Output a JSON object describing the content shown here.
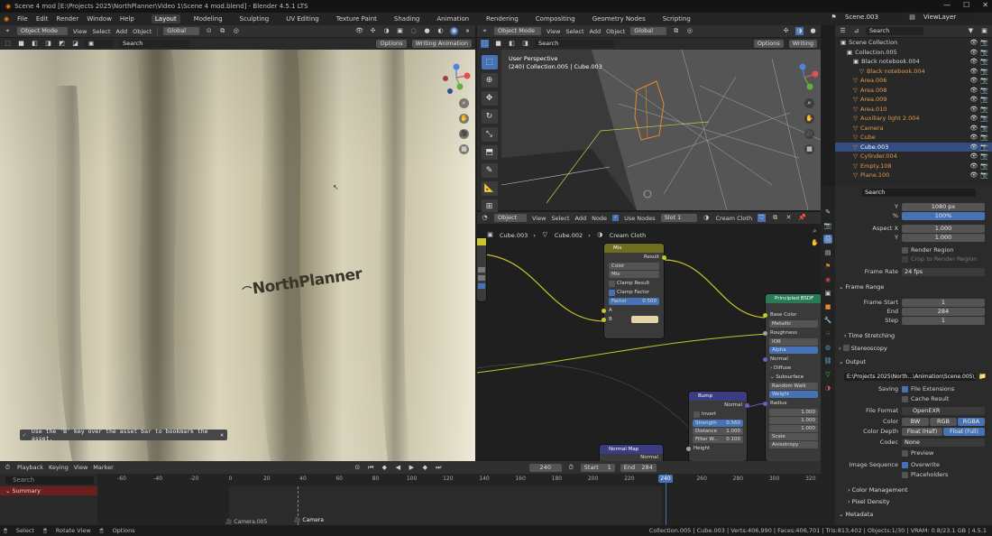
{
  "window": {
    "title": "Scene 4 mod [E:\\Projects 2025\\NorthPlanner\\Video 1\\Scene 4 mod.blend] - Blender 4.5.1 LTS"
  },
  "menu": {
    "items": [
      "File",
      "Edit",
      "Render",
      "Window",
      "Help"
    ]
  },
  "workspaces": [
    "Layout",
    "Modeling",
    "Sculpting",
    "UV Editing",
    "Texture Paint",
    "Shading",
    "Animation",
    "Rendering",
    "Compositing",
    "Geometry Nodes",
    "Scripting"
  ],
  "scene": {
    "name": "Scene.003",
    "view_layer": "ViewLayer"
  },
  "viewport_left": {
    "mode": "Object Mode",
    "menus": [
      "View",
      "Select",
      "Add",
      "Object"
    ],
    "transform": "Global",
    "search_placeholder": "Search",
    "options": "Options",
    "writing": "Writing Animation",
    "brand_text": "NorthPlanner",
    "toast": "Use the 'B' key over the asset bar to bookmark the asset."
  },
  "viewport_right": {
    "mode": "Object Mode",
    "menus": [
      "View",
      "Select",
      "Add",
      "Object"
    ],
    "transform": "Global",
    "options": "Options",
    "writing": "Writing",
    "persp": "User Perspective",
    "info": "(240) Collection.005 | Cube.003"
  },
  "node_editor": {
    "type": "Object",
    "menus": [
      "View",
      "Select",
      "Add",
      "Node"
    ],
    "use_nodes": "Use Nodes",
    "slot": "Slot 1",
    "material": "Cream Cloth",
    "breadcrumb": [
      "Cube.003",
      "Cube.002",
      "Cream Cloth"
    ],
    "mix": {
      "title": "Mix",
      "result": "Result",
      "type": "Color",
      "blend": "Mix",
      "clamp_result": "Clamp Result",
      "clamp_factor": "Clamp Factor",
      "factor_label": "Factor",
      "factor": "0.500",
      "a": "A",
      "b": "B"
    },
    "bsdf": {
      "title": "Principled BSDF",
      "rows": [
        "Base Color",
        "Metallic",
        "Roughness",
        "IOR",
        "Alpha",
        "Normal",
        "Diffuse",
        "Subsurface",
        "Random Walk",
        "Weight",
        "Radius",
        "1.000",
        "1.000",
        "1.000",
        "Scale",
        "Anisotropy"
      ]
    },
    "bump": {
      "title": "Bump",
      "normal": "Normal",
      "invert": "Invert",
      "strength_label": "Strength",
      "strength": "0.560",
      "distance_label": "Distance",
      "distance": "1.000",
      "filter_label": "Filter W...",
      "filter": "0.100",
      "height": "Height"
    },
    "normalmap": {
      "title": "Normal Map",
      "out": "Normal"
    }
  },
  "outliner": {
    "search_placeholder": "Search",
    "rows": [
      {
        "name": "Scene Collection",
        "indent": 0,
        "kind": "scene"
      },
      {
        "name": "Collection.005",
        "indent": 1,
        "kind": "coll"
      },
      {
        "name": "Black notebook.004",
        "indent": 2,
        "kind": "coll"
      },
      {
        "name": "Black notebook.004",
        "indent": 3,
        "kind": "obj"
      },
      {
        "name": "Area.006",
        "indent": 2,
        "kind": "obj"
      },
      {
        "name": "Area.008",
        "indent": 2,
        "kind": "obj"
      },
      {
        "name": "Area.009",
        "indent": 2,
        "kind": "obj"
      },
      {
        "name": "Area.010",
        "indent": 2,
        "kind": "obj"
      },
      {
        "name": "Auxiliary light 2.004",
        "indent": 2,
        "kind": "obj"
      },
      {
        "name": "Camera",
        "indent": 2,
        "kind": "obj"
      },
      {
        "name": "Cube",
        "indent": 2,
        "kind": "obj"
      },
      {
        "name": "Cube.003",
        "indent": 2,
        "kind": "obj",
        "selected": true
      },
      {
        "name": "Cylinder.004",
        "indent": 2,
        "kind": "obj"
      },
      {
        "name": "Empty.108",
        "indent": 2,
        "kind": "obj"
      },
      {
        "name": "Plane.100",
        "indent": 2,
        "kind": "obj"
      }
    ]
  },
  "properties": {
    "search_placeholder": "Search",
    "res_y_label": "Y",
    "res_y": "1080 px",
    "res_pct_label": "%",
    "res_pct": "100%",
    "aspect_x_label": "Aspect X",
    "aspect_x": "1.000",
    "aspect_y_label": "Y",
    "aspect_y": "1.000",
    "render_region": "Render Region",
    "crop_region": "Crop to Render Region",
    "frame_rate_label": "Frame Rate",
    "frame_rate": "24 fps",
    "frame_range": "Frame Range",
    "frame_start_label": "Frame Start",
    "frame_start": "1",
    "end_label": "End",
    "end": "284",
    "step_label": "Step",
    "step": "1",
    "time_stretching": "Time Stretching",
    "stereoscopy": "Stereoscopy",
    "output": "Output",
    "output_path": "E:\\Projects 2025\\North...\\Animation\\Scene.005\\",
    "saving_label": "Saving",
    "file_ext": "File Extensions",
    "cache_result": "Cache Result",
    "file_format_label": "File Format",
    "file_format": "OpenEXR",
    "color_label": "Color",
    "color_opts": [
      "BW",
      "RGB",
      "RGBA"
    ],
    "depth_label": "Color Depth",
    "depth_opts": [
      "Float (Half)",
      "Float (Full)"
    ],
    "codec_label": "Codec",
    "codec": "None",
    "preview": "Preview",
    "image_seq_label": "Image Sequence",
    "overwrite": "Overwrite",
    "placeholders": "Placeholders",
    "color_mgmt": "Color Management",
    "pixel_density": "Pixel Density",
    "metadata": "Metadata"
  },
  "timeline": {
    "menus": [
      "Playback",
      "Keying",
      "View",
      "Marker"
    ],
    "current_frame": "240",
    "start_label": "Start",
    "start": "1",
    "end_label": "End",
    "end": "284",
    "search_placeholder": "Search",
    "summary": "Summary",
    "ticks": [
      "-60",
      "-40",
      "-20",
      "0",
      "20",
      "40",
      "60",
      "80",
      "100",
      "120",
      "140",
      "160",
      "180",
      "200",
      "220",
      "240",
      "260",
      "280",
      "300",
      "320"
    ],
    "markers": [
      "Camera.005",
      "Camera"
    ]
  },
  "statusbar": {
    "left": [
      "Select",
      "Rotate View",
      "Options"
    ],
    "stats": "Collection.005 | Cube.003 | Verts:406,990 | Faces:406,701 | Tris:813,402 | Objects:1/30 | VRAM: 0.8/23.1 GB | 4.5.1"
  },
  "colors": {
    "accent": "#4772b3",
    "header": "#303030",
    "node_color": "#c7c729",
    "node_shader": "#2b7a57",
    "node_vector": "#6363c7",
    "orange": "#e09a4d"
  }
}
